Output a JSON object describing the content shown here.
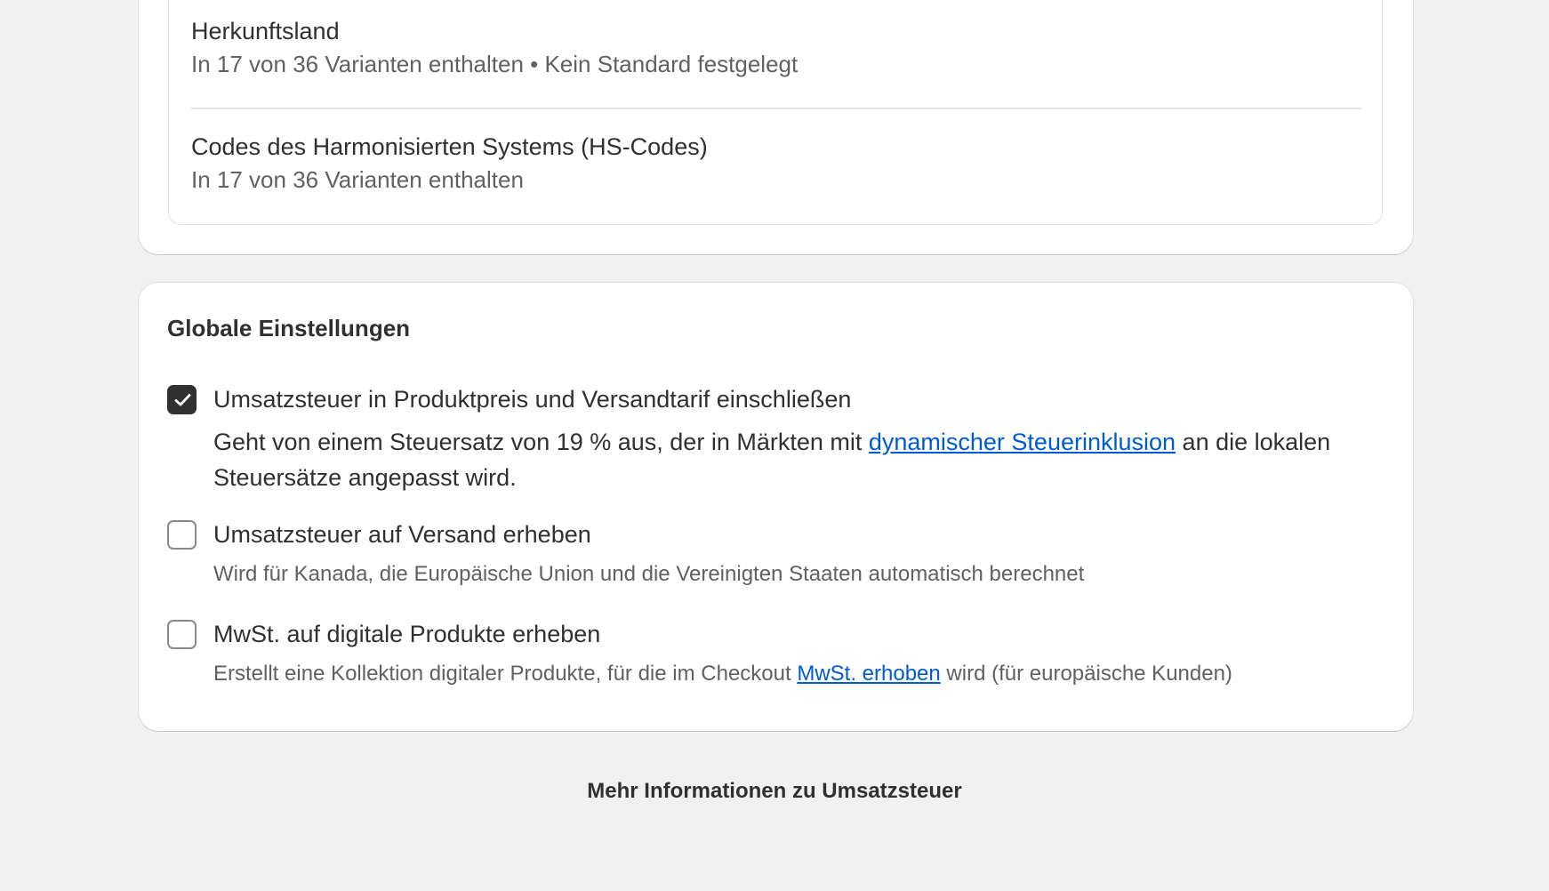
{
  "variant_card": {
    "rows": [
      {
        "title": "Herkunftsland",
        "subtitle": "In 17 von 36 Varianten enthalten • Kein Standard festgelegt"
      },
      {
        "title": "Codes des Harmonisierten Systems (HS-Codes)",
        "subtitle": "In 17 von 36 Varianten enthalten"
      }
    ]
  },
  "global_settings": {
    "heading": "Globale Einstellungen",
    "options": [
      {
        "label": "Umsatzsteuer in Produktpreis und Versandtarif einschließen",
        "checked": true,
        "desc_before": "Geht von einem Steuersatz von 19 % aus, der in Märkten mit ",
        "desc_link": "dynamischer Steuerinklusion",
        "desc_after": " an die lokalen Steuersätze angepasst wird."
      },
      {
        "label": "Umsatzsteuer auf Versand erheben",
        "checked": false,
        "desc": "Wird für Kanada, die Europäische Union und die Vereinigten Staaten automatisch berechnet"
      },
      {
        "label": "MwSt. auf digitale Produkte erheben",
        "checked": false,
        "desc_before": "Erstellt eine Kollektion digitaler Produkte, für die im Checkout ",
        "desc_link": "MwSt. erhoben",
        "desc_after": " wird (für europäische Kunden)"
      }
    ]
  },
  "footer": {
    "more_info_link": "Mehr Informationen zu Umsatzsteuer"
  },
  "colors": {
    "link": "#005bd3",
    "checkbox_checked": "#303030",
    "background": "#f1f1f1"
  },
  "icons": {
    "checkmark": "checkmark-icon"
  }
}
